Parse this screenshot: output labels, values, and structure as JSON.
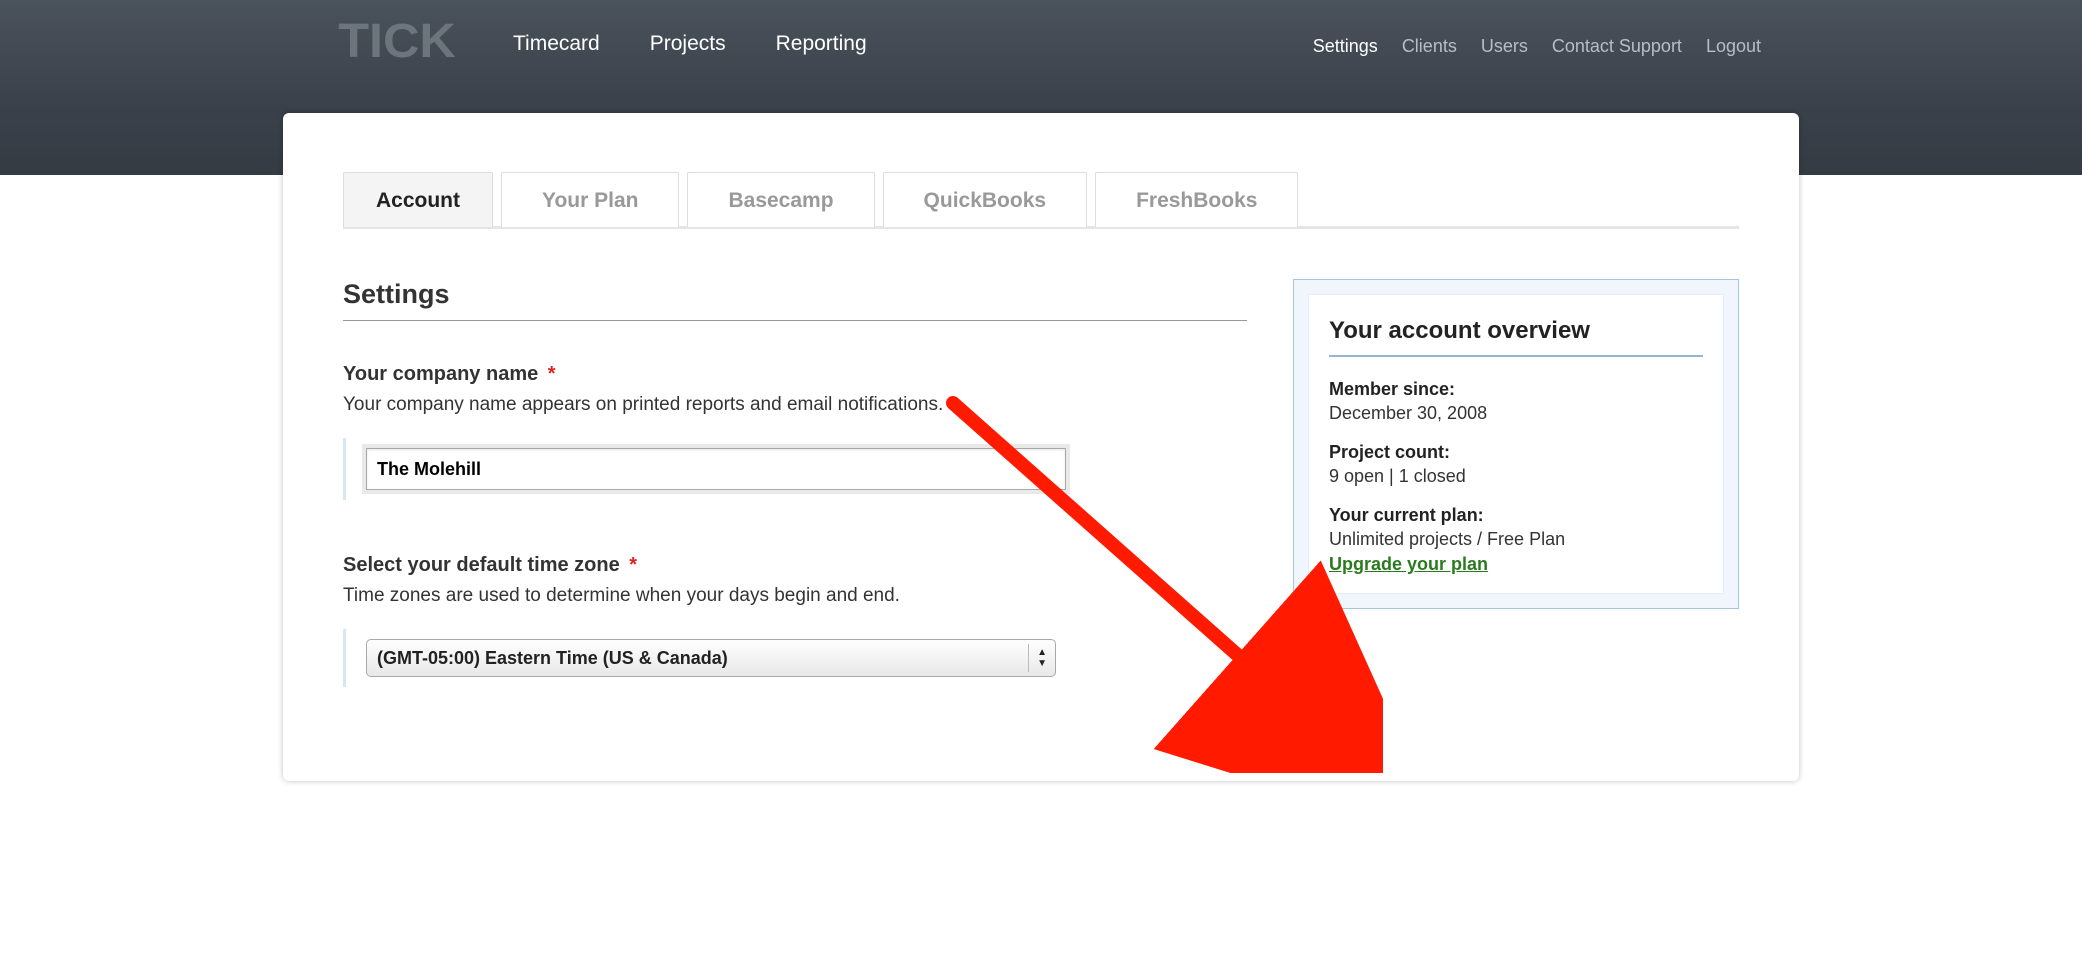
{
  "logo": "TICK",
  "main_nav": {
    "timecard": "Timecard",
    "projects": "Projects",
    "reporting": "Reporting"
  },
  "right_nav": {
    "settings": "Settings",
    "clients": "Clients",
    "users": "Users",
    "support": "Contact Support",
    "logout": "Logout"
  },
  "tabs": {
    "account": "Account",
    "plan": "Your Plan",
    "basecamp": "Basecamp",
    "quickbooks": "QuickBooks",
    "freshbooks": "FreshBooks"
  },
  "settings": {
    "title": "Settings",
    "company_label": "Your company name",
    "company_desc": "Your company name appears on printed reports and email notifications.",
    "company_value": "The Molehill",
    "tz_label": "Select your default time zone",
    "tz_desc": "Time zones are used to determine when your days begin and end.",
    "tz_value": "(GMT-05:00) Eastern Time (US & Canada)"
  },
  "overview": {
    "title": "Your account overview",
    "member_label": "Member since:",
    "member_value": "December 30, 2008",
    "project_label": "Project count:",
    "project_value": "9 open | 1 closed",
    "plan_label": "Your current plan:",
    "plan_value": "Unlimited projects / Free Plan",
    "upgrade": "Upgrade your plan"
  },
  "req": "*"
}
